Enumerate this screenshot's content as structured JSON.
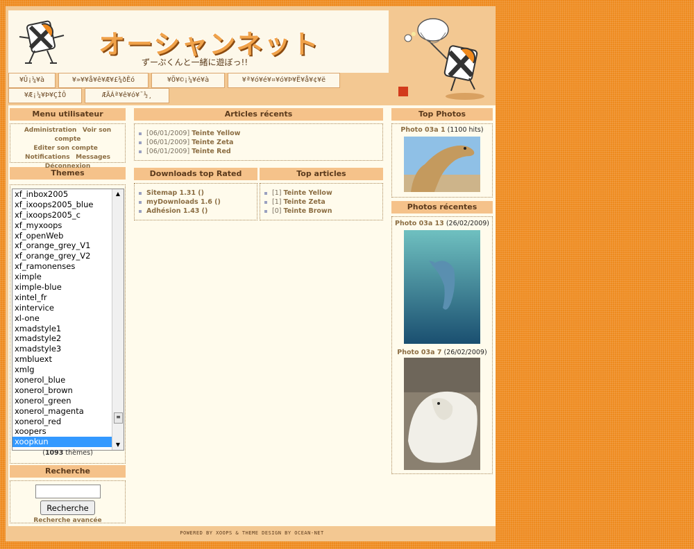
{
  "header": {
    "site_title": "オーシャンネット",
    "site_subtitle": "ずーぷくんと一緒に遊ぼっ!!",
    "nav_tabs": [
      "¥Û¡¼¥à",
      "¥»¥­¥å¥ê¥Æ¥£¾ðÊó",
      "¥Õ¥©¡¼¥é¥à",
      "¥ª¥ó¥é¥¤¥ó¥Þ¥Ë¥å¥¢¥ë",
      "¥Æ¡¼¥Þ¥ÇÌÔ",
      "ÆÃÁª¥ê¥ó¥¯½¸"
    ]
  },
  "user_menu": {
    "title": "Menu utilisateur",
    "links": [
      "Administration",
      "Voir son compte",
      "Editer son compte",
      "Notifications",
      "Messages",
      "Déconnexion"
    ]
  },
  "themes": {
    "title": "Themes",
    "items": [
      "xf_inbox2005",
      "xf_ixoops2005_blue",
      "xf_ixoops2005_c",
      "xf_myxoops",
      "xf_openWeb",
      "xf_orange_grey_V1",
      "xf_orange_grey_V2",
      "xf_ramonenses",
      "ximple",
      "ximple-blue",
      "xintel_fr",
      "xintervice",
      "xl-one",
      "xmadstyle1",
      "xmadstyle2",
      "xmadstyle3",
      "xmbluext",
      "xmlg",
      "xonerol_blue",
      "xonerol_brown",
      "xonerol_green",
      "xonerol_magenta",
      "xonerol_red",
      "xoopers",
      "xoopkun"
    ],
    "selected": "xoopkun",
    "count": "1093",
    "count_suffix": "thèmes"
  },
  "search": {
    "title": "Recherche",
    "button": "Recherche",
    "advanced": "Recherche avancée"
  },
  "recent_articles": {
    "title": "Articles récents",
    "items": [
      {
        "date": "[06/01/2009]",
        "title": "Teinte Yellow"
      },
      {
        "date": "[06/01/2009]",
        "title": "Teinte Zeta"
      },
      {
        "date": "[06/01/2009]",
        "title": "Teinte Red"
      }
    ]
  },
  "downloads": {
    "title": "Downloads top Rated",
    "items": [
      "Sitemap 1.31 ()",
      "myDownloads 1.6 ()",
      "Adhésion 1.43 ()"
    ]
  },
  "top_articles": {
    "title": "Top articles",
    "items": [
      {
        "count": "[1]",
        "title": "Teinte Yellow"
      },
      {
        "count": "[1]",
        "title": "Teinte Zeta"
      },
      {
        "count": "[0]",
        "title": "Teinte Brown"
      }
    ]
  },
  "top_photos": {
    "title": "Top Photos",
    "caption": "Photo 03a 1",
    "hits": "(1100 hits)"
  },
  "recent_photos": {
    "title": "Photos récentes",
    "items": [
      {
        "caption": "Photo 03a 13",
        "date": "(26/02/2009)"
      },
      {
        "caption": "Photo 03a 7",
        "date": "(26/02/2009)"
      }
    ]
  },
  "footer": {
    "text": "POWERED BY XOOPS & THEME DESIGN BY OCEAN-NET"
  },
  "colors": {
    "page_bg": "#ee8a1e",
    "block_title_bg": "#f5c28a",
    "content_bg": "#fffbec",
    "link": "#8b6d42"
  }
}
